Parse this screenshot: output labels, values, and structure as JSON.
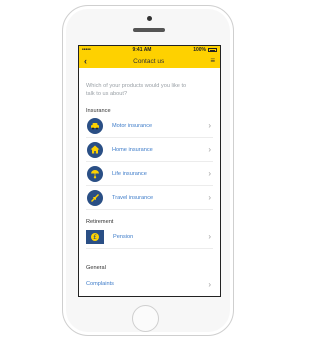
{
  "status_bar": {
    "carrier_dots": "•••••",
    "time": "9:41 AM",
    "battery": "100%"
  },
  "nav": {
    "back_icon": "chevron-left-icon",
    "title": "Contact us",
    "menu_icon": "hamburger-menu-icon"
  },
  "question": "Which of your products would you like to talk to us about?",
  "sections": {
    "insurance": {
      "heading": "Insurance",
      "items": [
        {
          "label": "Motor insurance",
          "icon": "car-icon"
        },
        {
          "label": "Home insurance",
          "icon": "house-icon"
        },
        {
          "label": "Life insurance",
          "icon": "umbrella-person-icon"
        },
        {
          "label": "Travel insurance",
          "icon": "airplane-icon"
        }
      ]
    },
    "retirement": {
      "heading": "Retirement",
      "items": [
        {
          "label": "Pension",
          "icon": "pension-pound-icon"
        }
      ]
    },
    "general": {
      "heading": "General",
      "items": [
        {
          "label": "Complaints"
        }
      ]
    }
  },
  "colors": {
    "accent": "#fed100",
    "icon_bg": "#2a4f85",
    "link": "#3e7cc9"
  }
}
